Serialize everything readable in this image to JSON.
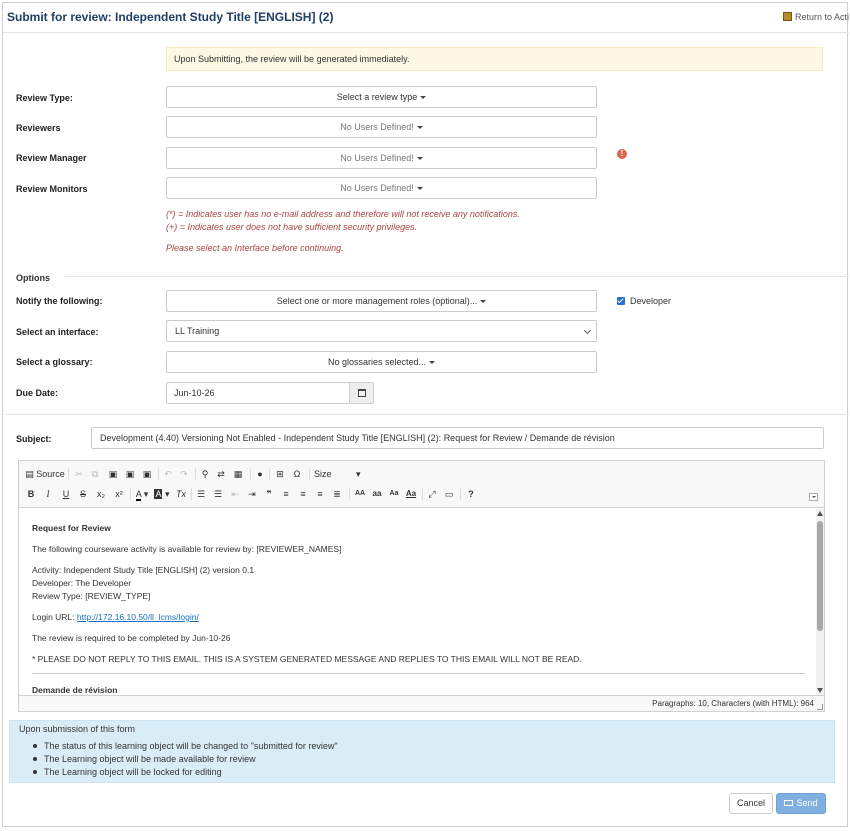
{
  "header": {
    "title": "Submit for review: Independent Study Title [ENGLISH] (2)",
    "return_label": "Return to Acti"
  },
  "notice": "Upon Submitting, the review will be generated immediately.",
  "form": {
    "review_type": {
      "label": "Review Type:",
      "value": "Select a review type"
    },
    "reviewers": {
      "label": "Reviewers",
      "value": "No Users Defined!"
    },
    "review_manager": {
      "label": "Review Manager",
      "value": "No Users Defined!"
    },
    "review_monitors": {
      "label": "Review Monitors",
      "value": "No Users Defined!"
    },
    "error_icon": "!",
    "note_email": "(*) = Indicates user has no e-mail address and therefore will not receive any notifications.",
    "note_security": "(+) = Indicates user does not have sufficient security privileges.",
    "note_interface": "Please select an Interface before continuing."
  },
  "options": {
    "heading": "Options",
    "notify": {
      "label": "Notify the following:",
      "value": "Select one or more management roles (optional)..."
    },
    "developer_checkbox": {
      "label": "Developer",
      "checked": true
    },
    "interface": {
      "label": "Select an interface:",
      "value": "LL Training"
    },
    "glossary": {
      "label": "Select a glossary:",
      "value": "No glossaries selected..."
    },
    "due_date": {
      "label": "Due Date:",
      "value": "Jun-10-26"
    }
  },
  "subject": {
    "label": "Subject:",
    "value": "Development (4.40) Versioning Not Enabled - Independent Study Title [ENGLISH] (2): Request for Review  / Demande de révision"
  },
  "editor": {
    "toolbar": {
      "source": "Source",
      "size": "Size",
      "omega": "Ω",
      "bold": "B",
      "italic": "I",
      "underline": "U",
      "strike": "S",
      "subscript": "x₂",
      "superscript": "x²",
      "text_color": "A",
      "bg_color": "A",
      "remove_format": "Tx",
      "blockquote": "❞",
      "upper": "AA",
      "lower": "aa",
      "title_case": "Aa",
      "help": "?"
    },
    "content": {
      "heading": "Request for Review",
      "intro": "The following courseware activity is available for review by: [REVIEWER_NAMES]",
      "activity": "Activity: Independent Study Title [ENGLISH] (2) version 0.1",
      "developer": "Developer: The Developer",
      "review_type": "Review Type: [REVIEW_TYPE]",
      "login_label": "Login URL: ",
      "login_url": "http://172.16.10.50/ll_lcms/login/",
      "due": "The review is required to be completed by Jun-10-26",
      "disclaimer": "* PLEASE DO NOT REPLY TO THIS EMAIL. THIS IS A SYSTEM GENERATED MESSAGE AND REPLIES TO THIS EMAIL WILL NOT BE READ.",
      "heading_fr": "Demande de révision"
    },
    "status": "Paragraphs: 10, Characters (with HTML): 964"
  },
  "info": {
    "heading": "Upon submission of this form",
    "items": [
      "The status of this learning object will be changed to \"submitted for review\"",
      "The Learning object will be made available for review",
      "The Learning object will be locked for editing"
    ]
  },
  "buttons": {
    "cancel": "Cancel",
    "send": "Send"
  },
  "colors": {
    "title": "#1f3f66",
    "notice_bg": "#fcf8e3",
    "error_text": "#a94442",
    "info_bg": "#d9edf7",
    "send_bg": "#7fb0df",
    "link": "#1a6fc1"
  }
}
